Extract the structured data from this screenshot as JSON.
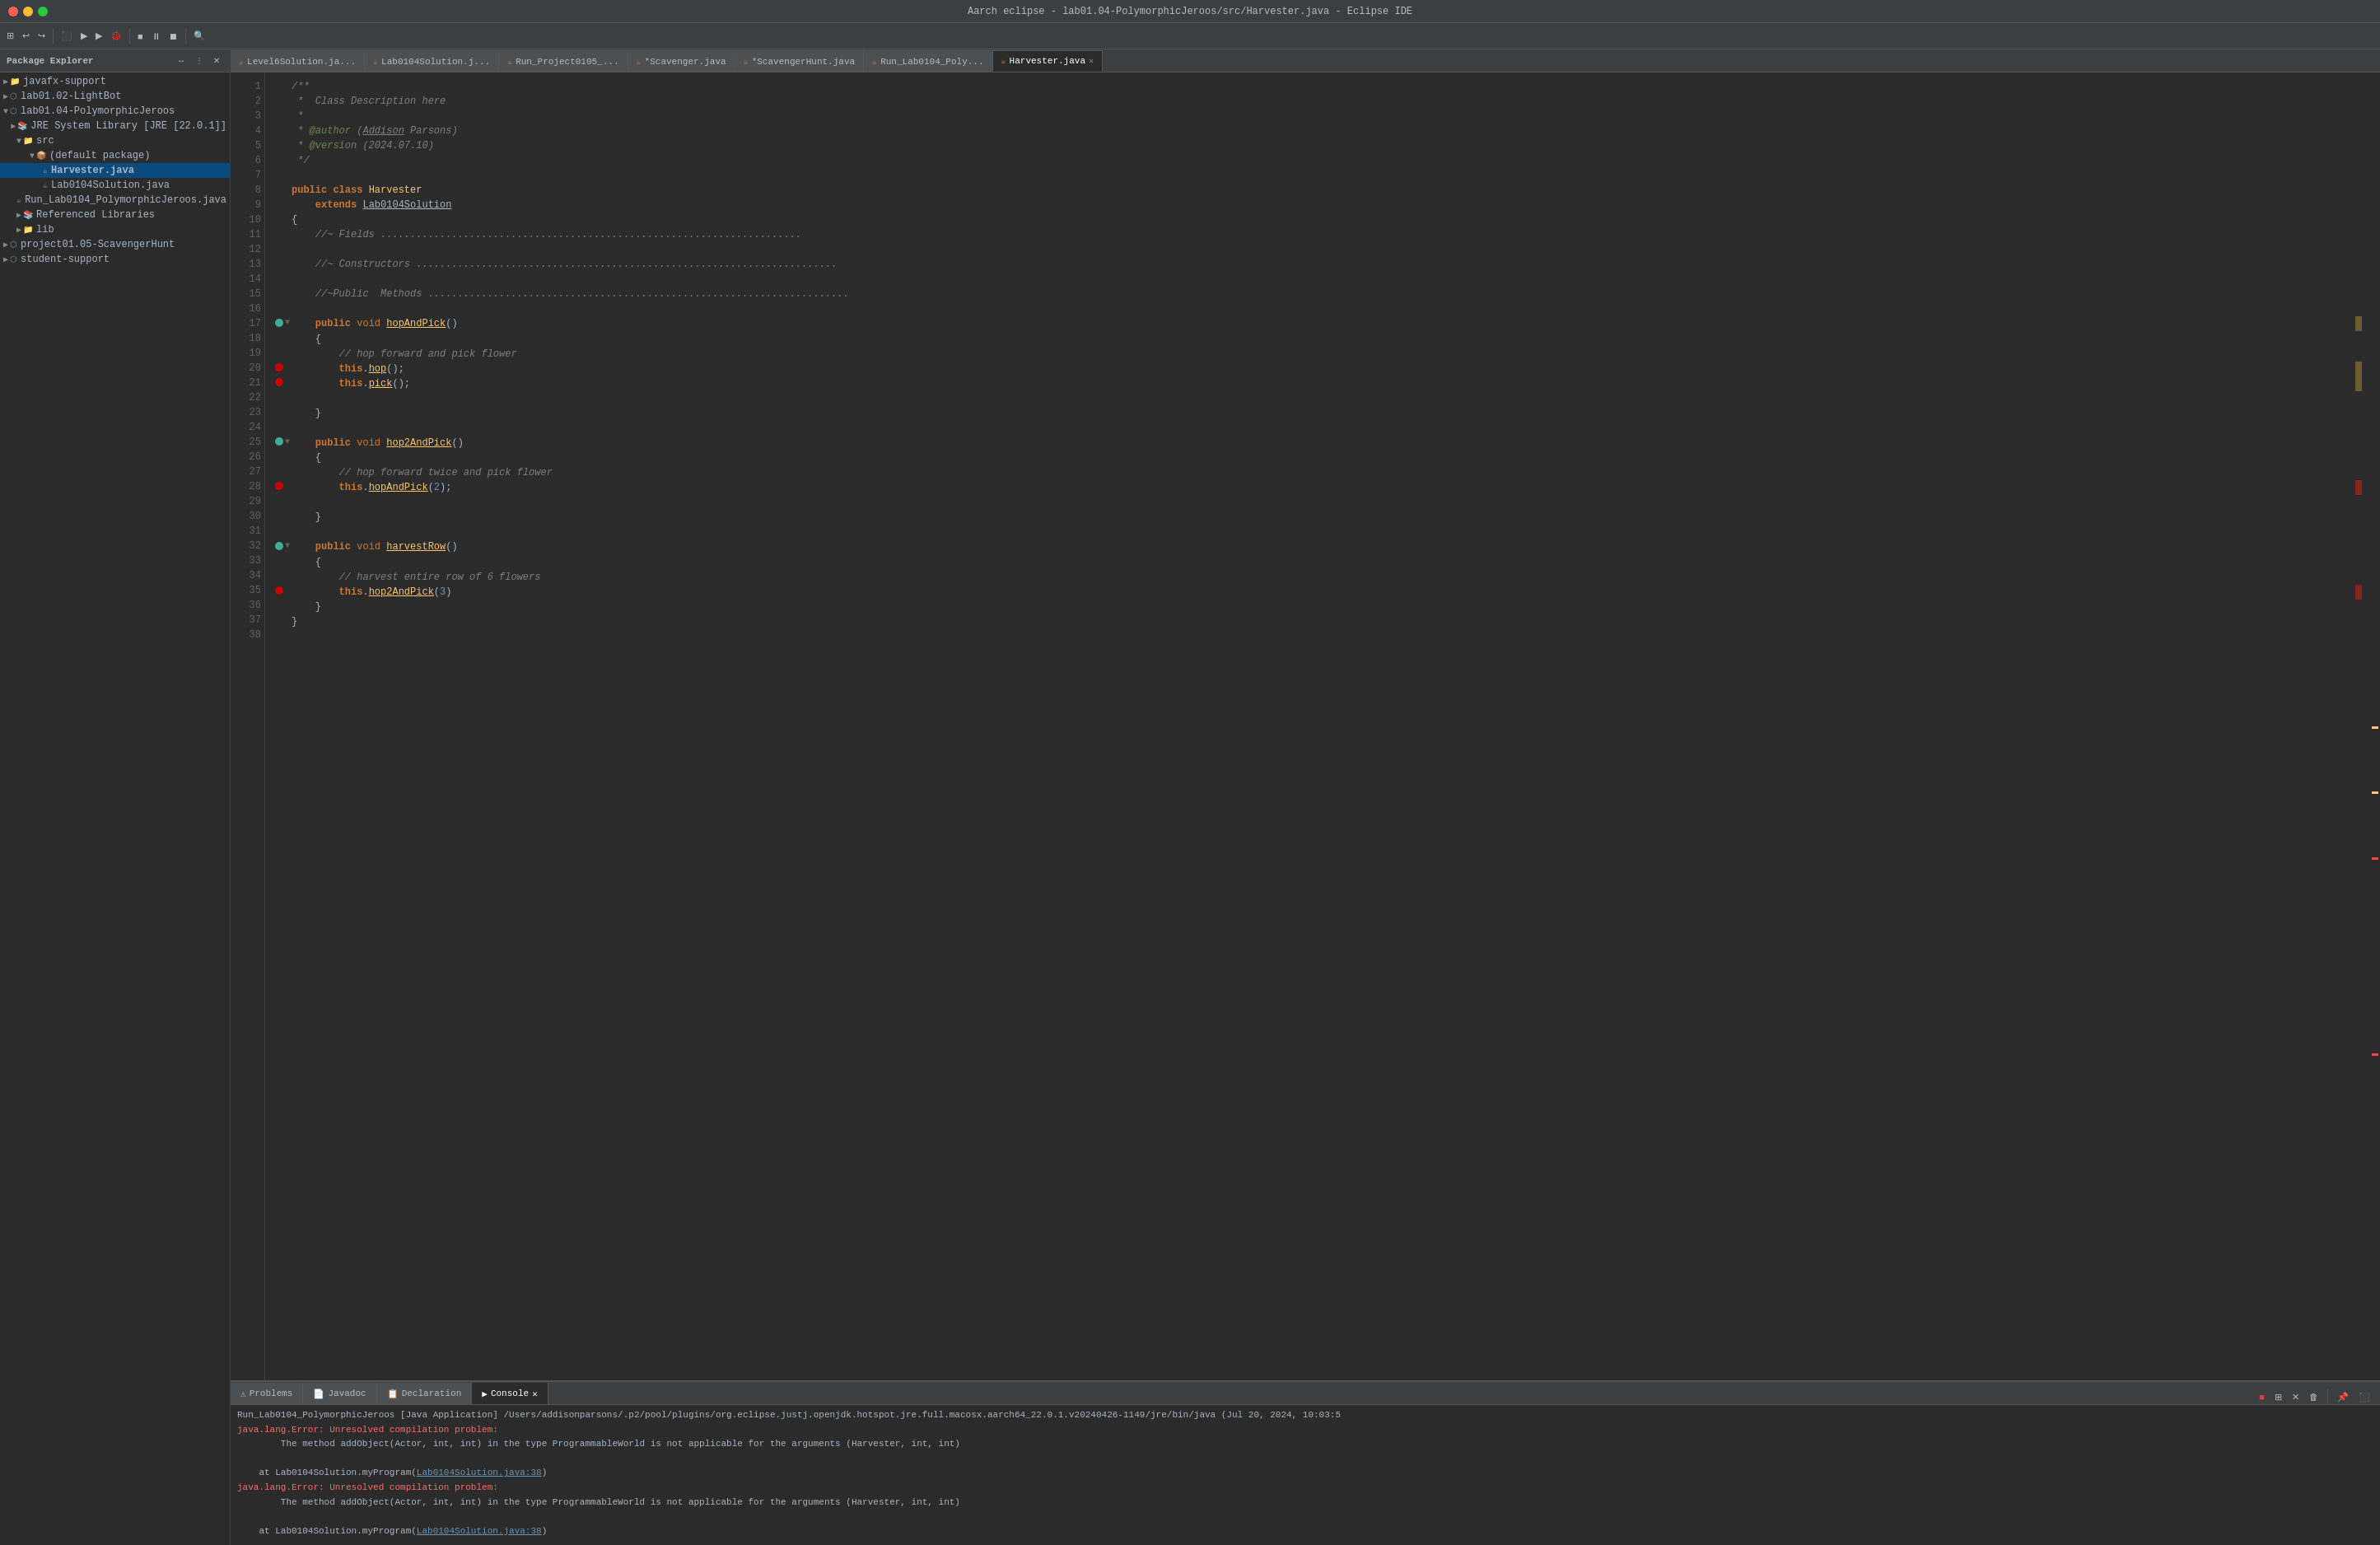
{
  "titleBar": {
    "title": "Aarch eclipse - lab01.04-PolymorphicJeroos/src/Harvester.java - Eclipse IDE"
  },
  "sidebar": {
    "title": "Package Explorer",
    "items": [
      {
        "id": "javafx-support",
        "label": "javafx-support",
        "indent": 0,
        "type": "folder",
        "expanded": false
      },
      {
        "id": "lab01.02",
        "label": "lab01.02-LightBot",
        "indent": 0,
        "type": "project",
        "expanded": false
      },
      {
        "id": "lab01.04",
        "label": "lab01.04-PolymorphicJeroos",
        "indent": 0,
        "type": "project",
        "expanded": true
      },
      {
        "id": "jre",
        "label": "JRE System Library [JRE [22.0.1]]",
        "indent": 1,
        "type": "lib",
        "expanded": false
      },
      {
        "id": "src",
        "label": "src",
        "indent": 1,
        "type": "folder",
        "expanded": true
      },
      {
        "id": "default-pkg",
        "label": "(default package)",
        "indent": 2,
        "type": "package",
        "expanded": true
      },
      {
        "id": "Harvester.java",
        "label": "Harvester.java",
        "indent": 3,
        "type": "java-file",
        "selected": true
      },
      {
        "id": "Lab0104Solution.java",
        "label": "Lab0104Solution.java",
        "indent": 3,
        "type": "java-file"
      },
      {
        "id": "Run_Lab0104.java",
        "label": "Run_Lab0104_PolymorphicJeroos.java",
        "indent": 3,
        "type": "java-file"
      },
      {
        "id": "ref-libs",
        "label": "Referenced Libraries",
        "indent": 1,
        "type": "folder",
        "expanded": false
      },
      {
        "id": "lib",
        "label": "lib",
        "indent": 1,
        "type": "folder",
        "expanded": false
      },
      {
        "id": "project0105",
        "label": "project01.05-ScavengerHunt",
        "indent": 0,
        "type": "project",
        "expanded": false
      },
      {
        "id": "student-support",
        "label": "student-support",
        "indent": 0,
        "type": "project",
        "expanded": false
      }
    ]
  },
  "tabs": [
    {
      "id": "Level6Solution",
      "label": "Level6Solution.ja...",
      "active": false,
      "modified": false
    },
    {
      "id": "Lab0104Solution",
      "label": "Lab0104Solution.j...",
      "active": false,
      "modified": false
    },
    {
      "id": "Run_Project0105",
      "label": "Run_Project0105_...",
      "active": false,
      "modified": false
    },
    {
      "id": "Scavenger",
      "label": "*Scavenger.java",
      "active": false,
      "modified": true
    },
    {
      "id": "ScavengerHunt",
      "label": "*ScavengerHunt.java",
      "active": false,
      "modified": true
    },
    {
      "id": "Run_Lab0104_Poly",
      "label": "Run_Lab0104_Poly...",
      "active": false,
      "modified": false
    },
    {
      "id": "Harvester",
      "label": "Harvester.java",
      "active": true,
      "modified": false
    }
  ],
  "codeLines": [
    {
      "num": 1,
      "content": "/**",
      "type": "comment"
    },
    {
      "num": 2,
      "content": " *  Class Description here",
      "type": "comment"
    },
    {
      "num": 3,
      "content": " *",
      "type": "comment"
    },
    {
      "num": 4,
      "content": " * @author (Addison Parsons)",
      "type": "comment-author"
    },
    {
      "num": 5,
      "content": " * @version (2024.07.10)",
      "type": "comment"
    },
    {
      "num": 6,
      "content": " */",
      "type": "comment"
    },
    {
      "num": 7,
      "content": "",
      "type": "blank"
    },
    {
      "num": 8,
      "content": "public class Harvester",
      "type": "class-decl"
    },
    {
      "num": 9,
      "content": "    extends Lab0104Solution",
      "type": "extends"
    },
    {
      "num": 10,
      "content": "{",
      "type": "brace"
    },
    {
      "num": 11,
      "content": "    //~ Fields .......................................................",
      "type": "comment-section"
    },
    {
      "num": 12,
      "content": "",
      "type": "blank"
    },
    {
      "num": 13,
      "content": "    //~ Constructors .......................................................",
      "type": "comment-section"
    },
    {
      "num": 14,
      "content": "",
      "type": "blank"
    },
    {
      "num": 15,
      "content": "    //~Public  Methods .......................................................",
      "type": "comment-section"
    },
    {
      "num": 16,
      "content": "",
      "type": "blank"
    },
    {
      "num": 17,
      "content": "    public void hopAndPick()",
      "type": "method-decl",
      "fold": true
    },
    {
      "num": 18,
      "content": "    {",
      "type": "brace"
    },
    {
      "num": 19,
      "content": "        // hop forward and pick flower",
      "type": "comment"
    },
    {
      "num": 20,
      "content": "        this.hop();",
      "type": "code-this",
      "marker": "yellow"
    },
    {
      "num": 21,
      "content": "        this.pick();",
      "type": "code-this",
      "marker": "yellow"
    },
    {
      "num": 22,
      "content": "",
      "type": "blank"
    },
    {
      "num": 23,
      "content": "    }",
      "type": "brace"
    },
    {
      "num": 24,
      "content": "",
      "type": "blank"
    },
    {
      "num": 25,
      "content": "    public void hop2AndPick()",
      "type": "method-decl",
      "fold": true
    },
    {
      "num": 26,
      "content": "    {",
      "type": "brace"
    },
    {
      "num": 27,
      "content": "        // hop forward twice and pick flower",
      "type": "comment"
    },
    {
      "num": 28,
      "content": "        this.hopAndPick(2);",
      "type": "code-this",
      "marker": "red"
    },
    {
      "num": 29,
      "content": "",
      "type": "blank"
    },
    {
      "num": 30,
      "content": "    }",
      "type": "brace"
    },
    {
      "num": 31,
      "content": "",
      "type": "blank"
    },
    {
      "num": 32,
      "content": "    public void harvestRow()",
      "type": "method-decl",
      "fold": true
    },
    {
      "num": 33,
      "content": "    {",
      "type": "brace"
    },
    {
      "num": 34,
      "content": "        // harvest entire row of 6 flowers",
      "type": "comment"
    },
    {
      "num": 35,
      "content": "        this.hop2AndPick(3)",
      "type": "code-this",
      "marker": "red",
      "error": true
    },
    {
      "num": 36,
      "content": "    }",
      "type": "brace"
    },
    {
      "num": 37,
      "content": "}",
      "type": "brace"
    },
    {
      "num": 38,
      "content": "",
      "type": "blank"
    }
  ],
  "bottomPanel": {
    "tabs": [
      {
        "id": "problems",
        "label": "Problems",
        "active": false
      },
      {
        "id": "javadoc",
        "label": "Javadoc",
        "active": false
      },
      {
        "id": "declaration",
        "label": "Declaration",
        "active": false
      },
      {
        "id": "console",
        "label": "Console",
        "active": true
      }
    ],
    "consoleHeader": "Run_Lab0104_PolymorphicJeroos [Java Application] /Users/addisonparsons/.p2/pool/plugins/org.eclipse.justj.openjdk.hotspot.jre.full.macosx.aarch64_22.0.1.v20240426-1149/jre/bin/java  (Jul 20, 2024, 10:03:5",
    "consoleLines": [
      {
        "type": "error",
        "text": "java.lang.Error: Unresolved compilation problem:"
      },
      {
        "type": "normal",
        "text": "\tThe method addObject(Actor, int, int) in the type ProgrammableWorld is not applicable for the arguments (Harvester, int, int)"
      },
      {
        "type": "blank"
      },
      {
        "type": "link",
        "text": "\tat Lab0104Solution.myProgram(Lab0104Solution.java:38)"
      },
      {
        "type": "error",
        "text": "java.lang.Error: Unresolved compilation problem:"
      },
      {
        "type": "normal",
        "text": "\tThe method addObject(Actor, int, int) in the type ProgrammableWorld is not applicable for the arguments (Harvester, int, int)"
      },
      {
        "type": "blank"
      },
      {
        "type": "link",
        "text": "\tat Lab0104Solution.myProgram(Lab0104Solution.java:38)"
      }
    ]
  }
}
